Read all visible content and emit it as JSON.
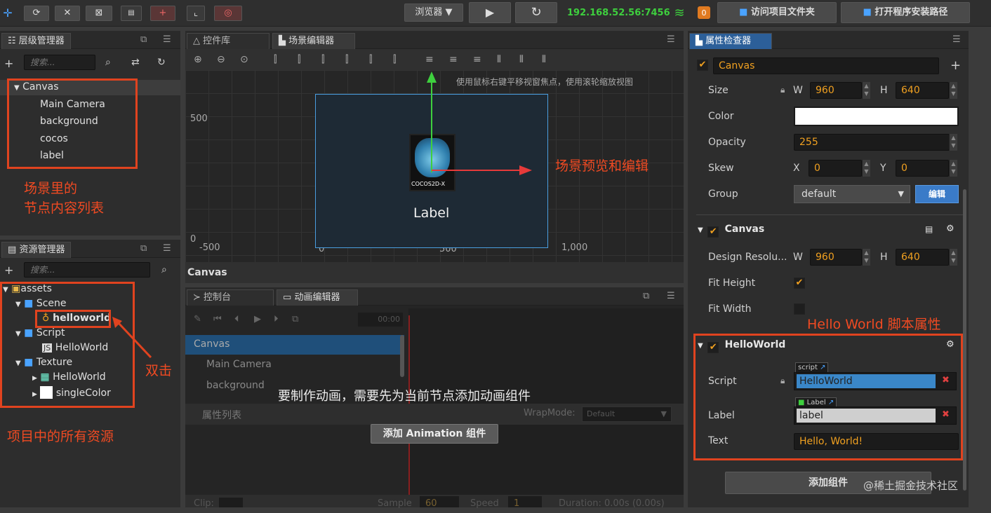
{
  "toolbar": {
    "browser_select": "浏览器 ▼",
    "play_icon": "▶",
    "refresh_icon": "↻",
    "ip": "192.168.52.56:7456",
    "badge": "0",
    "open_project_folder": "访问项目文件夹",
    "open_install_path": "打开程序安装路径"
  },
  "hierarchy": {
    "tab": "层级管理器",
    "search_placeholder": "搜索...",
    "items": [
      "Canvas",
      "Main Camera",
      "background",
      "cocos",
      "label"
    ],
    "annotation_line1": "场景里的",
    "annotation_line2": "节点内容列表"
  },
  "assets": {
    "tab": "资源管理器",
    "search_placeholder": "搜索...",
    "items": [
      "assets",
      "Scene",
      "helloworld",
      "Script",
      "HelloWorld",
      "Texture",
      "HelloWorld",
      "singleColor"
    ],
    "annotation_dblclick": "双击",
    "annotation_all": "项目中的所有资源"
  },
  "scene": {
    "tab_widgets": "控件库",
    "tab_scene": "场景编辑器",
    "hint": "使用鼠标右键平移视窗焦点，使用滚轮缩放视图",
    "y_label_500": "500",
    "y_label_0": "0",
    "x_label_neg500": "-500",
    "x_label_0": "0",
    "x_label_500": "500",
    "x_label_1000": "1,000",
    "label_text": "Label",
    "cocos_logo": "COCOS2D-X",
    "annotation": "场景预览和编辑",
    "footer": "Canvas"
  },
  "animation": {
    "tab_console": "控制台",
    "tab_anim": "动画编辑器",
    "time": "00:00",
    "nodes": [
      "Canvas",
      "Main Camera",
      "background"
    ],
    "props": "属性列表",
    "wrapmode_label": "WrapMode:",
    "wrapmode_value": "Default",
    "overlay_text": "要制作动画，需要先为当前节点添加动画组件",
    "add_button": "添加 Animation 组件",
    "clip_label": "Clip:",
    "sample_label": "Sample",
    "sample_value": "60",
    "speed_label": "Speed",
    "speed_value": "1",
    "duration": "Duration: 0.00s (0.00s)"
  },
  "inspector": {
    "tab": "属性检查器",
    "node_name": "Canvas",
    "size_label": "Size",
    "w": "960",
    "h": "640",
    "color_label": "Color",
    "opacity_label": "Opacity",
    "opacity": "255",
    "skew_label": "Skew",
    "skew_x": "0",
    "skew_y": "0",
    "group_label": "Group",
    "group_value": "default",
    "edit_button": "编辑",
    "canvas_section": "Canvas",
    "design_res_label": "Design Resolu...",
    "design_w": "960",
    "design_h": "640",
    "fit_height_label": "Fit Height",
    "fit_width_label": "Fit Width",
    "annotation": "Hello World 脚本属性",
    "helloworld_section": "HelloWorld",
    "script_label": "Script",
    "script_tag": "script",
    "script_value": "HelloWorld",
    "label_label": "Label",
    "label_tag": "Label",
    "label_value": "label",
    "text_label": "Text",
    "text_value": "Hello, World!",
    "add_component": "添加组件",
    "watermark": "@稀土掘金技术社区",
    "letter_W": "W",
    "letter_H": "H",
    "letter_X": "X",
    "letter_Y": "Y"
  },
  "colors": {
    "accent_blue": "#2c5f99",
    "annotation_red": "#e0431f",
    "value_orange": "#f0a020",
    "ip_green": "#3ecf3e"
  }
}
